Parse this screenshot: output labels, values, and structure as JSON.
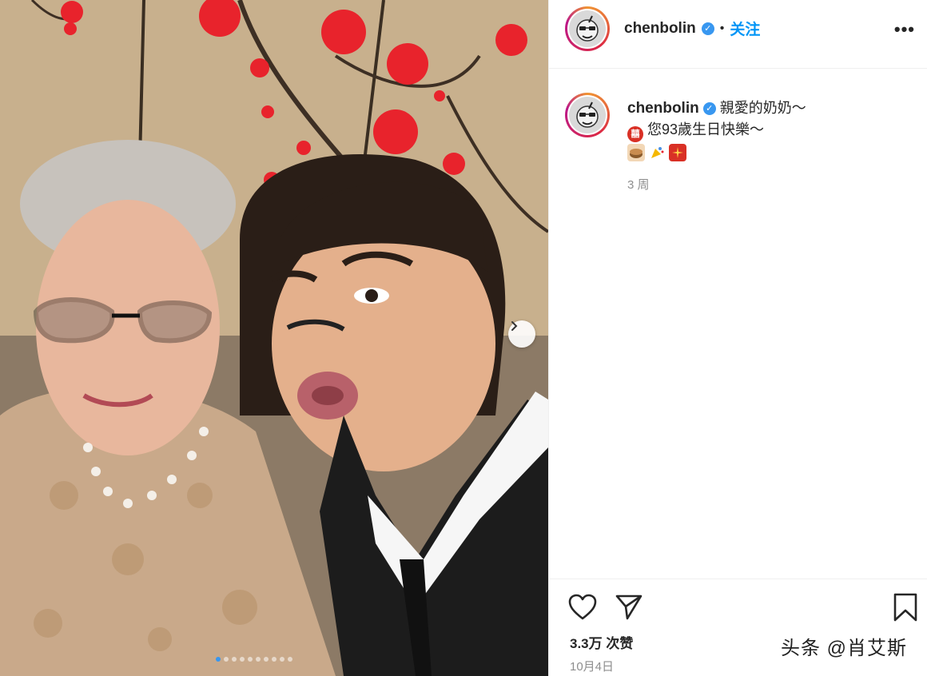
{
  "post": {
    "username": "chenbolin",
    "separator": "•",
    "follow_label": "关注",
    "more_label": "•••",
    "caption_line1": "親愛的奶奶～",
    "caption_line2": "您93歲生日快樂～",
    "time_ago": "3 周",
    "likes": "3.3万 次赞",
    "date": "10月4日"
  },
  "icons": {
    "verified": "verified-badge-icon",
    "next": "chevron-right-icon",
    "like": "heart-icon",
    "share": "paper-plane-icon",
    "save": "bookmark-icon"
  },
  "carousel": {
    "slide_count": 10,
    "active_index": 0
  },
  "watermark": "头条 @肖艾斯",
  "colors": {
    "link": "#0095f6",
    "verified": "#3897f0",
    "muted": "#8e8e8e"
  }
}
